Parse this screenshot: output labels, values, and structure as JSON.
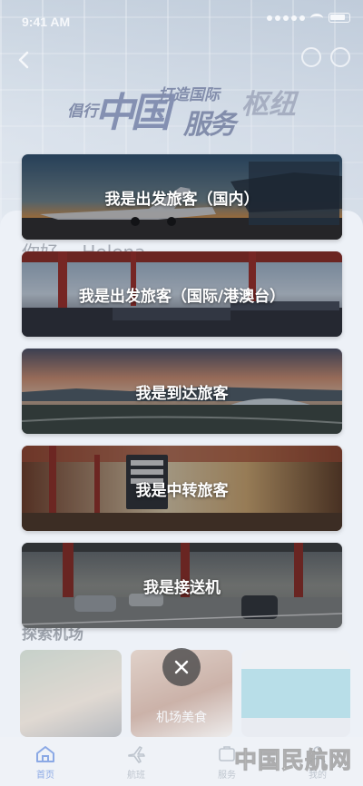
{
  "status_bar": {
    "time": "9:41 AM"
  },
  "banner": {
    "slogan_part1": "倡行",
    "slogan_big": "中国",
    "slogan_part2": "打造国际",
    "slogan_mid": "服务",
    "slogan_hub": "枢纽"
  },
  "greeting": "你好， Helena",
  "passenger_options": [
    {
      "label": "我是出发旅客（国内）"
    },
    {
      "label": "我是出发旅客（国际/港澳台）"
    },
    {
      "label": "我是到达旅客"
    },
    {
      "label": "我是中转旅客"
    },
    {
      "label": "我是接送机"
    }
  ],
  "explore": {
    "title": "探索机场",
    "card_label": "机场美食"
  },
  "tabbar": {
    "items": [
      {
        "label": "首页",
        "icon": "home-icon"
      },
      {
        "label": "航班",
        "icon": "plane-icon"
      },
      {
        "label": "服务",
        "icon": "service-icon"
      },
      {
        "label": "我的",
        "icon": "user-icon"
      }
    ]
  },
  "watermark": "中国民航网",
  "colors": {
    "accent": "#3d6fd8",
    "slogan": "#2d3d6e",
    "card_text": "#ffffff"
  }
}
